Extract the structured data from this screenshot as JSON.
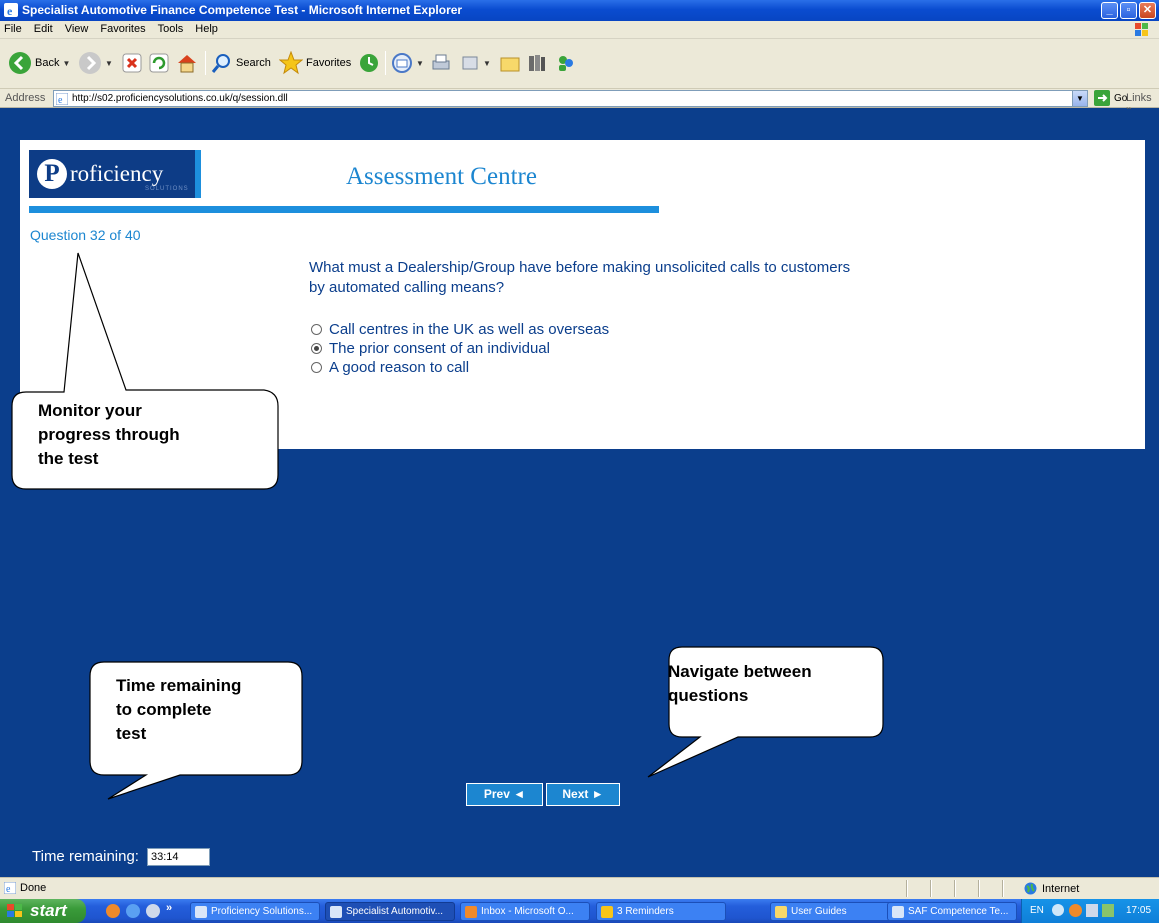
{
  "window": {
    "title": "Specialist Automotive Finance Competence Test - Microsoft Internet Explorer",
    "controls": [
      "_",
      "▫",
      "✕"
    ]
  },
  "menu": [
    "File",
    "Edit",
    "View",
    "Favorites",
    "Tools",
    "Help"
  ],
  "toolbar": {
    "back_label": "Back",
    "search_label": "Search",
    "favorites_label": "Favorites"
  },
  "address": {
    "label": "Address",
    "url": "http://s02.proficiencysolutions.co.uk/q/session.dll",
    "go_label": "Go",
    "links_label": "Links",
    "links_chevron": "»"
  },
  "header": {
    "logo_letter": "P",
    "logo_rest": "roficiency",
    "logo_sub": "SOLUTIONS",
    "title": "Assessment Centre"
  },
  "question": {
    "counter": "Question 32 of 40",
    "text": "What must a Dealership/Group have before making unsolicited calls to customers by automated calling means?",
    "options": [
      {
        "label": "Call centres in the UK as well as overseas",
        "selected": false
      },
      {
        "label": "The prior consent of an individual",
        "selected": true
      },
      {
        "label": "A good reason to call",
        "selected": false
      }
    ]
  },
  "callouts": {
    "progress": [
      "Monitor your",
      "progress through",
      "the test"
    ],
    "time": [
      "Time remaining",
      "to complete",
      "test"
    ],
    "navigate": [
      "Navigate between",
      "questions"
    ]
  },
  "navigation": {
    "prev_label": "Prev ◄",
    "next_label": "Next ►"
  },
  "timer": {
    "label": "Time remaining:",
    "value": "33:14"
  },
  "statusbar": {
    "status": "Done",
    "zone": "Internet"
  },
  "taskbar": {
    "start_label": "start",
    "quicklaunch_more": "»",
    "tasks": [
      "Proficiency Solutions...",
      "Specialist Automotiv...",
      "Inbox - Microsoft O...",
      "3 Reminders",
      "User Guides",
      "SAF Competence Te..."
    ],
    "language": "EN",
    "clock": "17:05"
  }
}
